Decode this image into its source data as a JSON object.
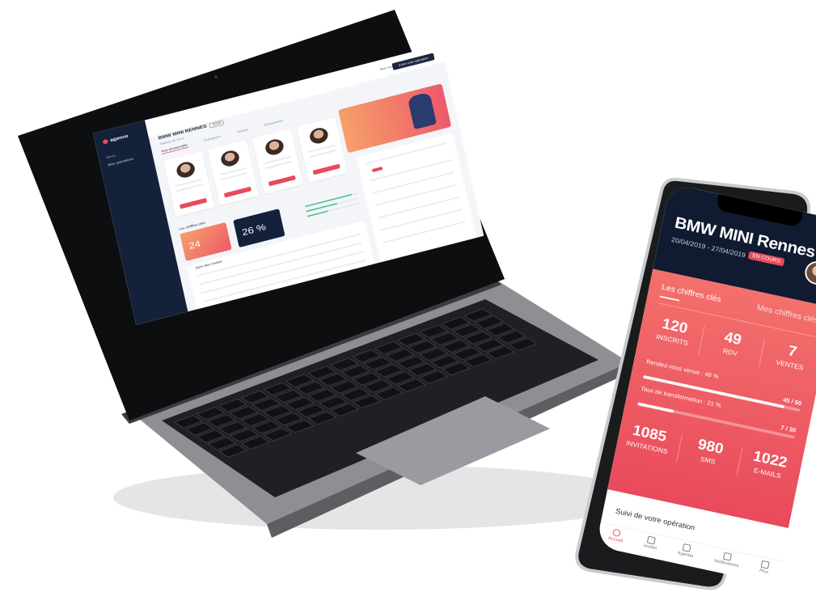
{
  "laptop": {
    "app_name": "agence",
    "nav_section": "Menu",
    "nav_item": "Mes opérations",
    "page_title": "BMW MINI RENNES",
    "page_badge": "2019",
    "page_subtitle": "Tableau de bord",
    "tabs": [
      "Vue d'ensemble",
      "Invitations",
      "Ventes",
      "Documents"
    ],
    "cta_label": "Créer une opération",
    "user_label": "Mon compte",
    "kpi_section": "Les chiffres clés",
    "kpi_tiles": [
      "24",
      "26 %"
    ],
    "table_label": "Suivi des invités"
  },
  "phone": {
    "title": "BMW MINI Rennes",
    "dates": "20/04/2019 - 27/04/2019",
    "status": "EN COURS",
    "tab_active": "Les chiffres clés",
    "tab_inactive": "Mes chiffres clés",
    "top_stats": [
      {
        "value": "120",
        "label": "INSCRITS"
      },
      {
        "value": "49",
        "label": "RDV"
      },
      {
        "value": "7",
        "label": "VENTES"
      }
    ],
    "progress": [
      {
        "label": "Rendez-vous venus : 48 %",
        "ratio": "45 / 50",
        "fraction": 0.9
      },
      {
        "label": "Taux de transformation : 21 %",
        "ratio": "7 / 30",
        "fraction": 0.23
      }
    ],
    "bottom_stats": [
      {
        "value": "1085",
        "label": "INVITATIONS"
      },
      {
        "value": "980",
        "label": "SMS"
      },
      {
        "value": "1022",
        "label": "E-MAILS"
      }
    ],
    "follow_label": "Suivi de votre opération",
    "nav": [
      "Accueil",
      "Invités",
      "Agenda",
      "Notifications",
      "Plus"
    ]
  },
  "colors": {
    "accent": "#e94a5c",
    "navy": "#101a30",
    "laptop_body": "#8a8b8f",
    "keyboard": "#1c1c1e"
  }
}
